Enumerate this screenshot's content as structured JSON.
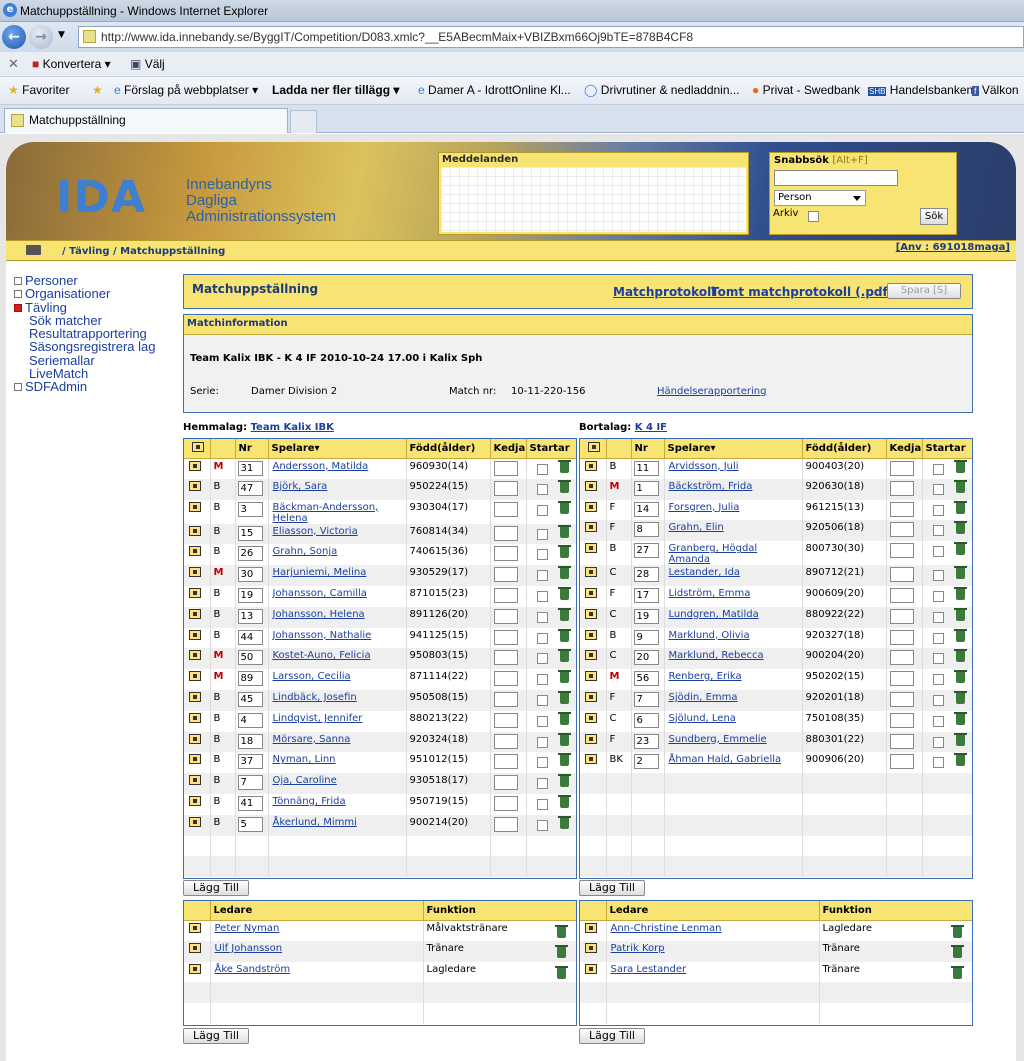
{
  "browser": {
    "title": "Matchuppställning - Windows Internet Explorer",
    "url": "http://www.ida.innebandy.se/ByggIT/Competition/D083.xmlc?__E5ABecmMaix+VBIZBxm66Oj9bTE=878B4CF8",
    "cmd": {
      "convert": "Konvertera",
      "select": "Välj"
    },
    "favorites": [
      "Favoriter",
      "Förslag på webbplatser",
      "Ladda ner fler tillägg",
      "Damer A - IdrottOnline Kl...",
      "Drivrutiner & nedladdnin...",
      "Privat - Swedbank",
      "Handelsbanken",
      "Välkon"
    ],
    "tab": "Matchuppställning"
  },
  "header": {
    "logo": "IDA",
    "logo_lines": [
      "Innebandyns",
      "Dagliga",
      "Administrationssystem"
    ],
    "messages_title": "Meddelanden",
    "quicksearch_title": "Snabbsök",
    "quicksearch_hint": "[Alt+F]",
    "search_type": "Person",
    "archive_label": "Arkiv",
    "search_button": "Sök",
    "breadcrumb": "/ Tävling / Matchuppställning",
    "user": "[Anv : 691018maga]"
  },
  "nav": {
    "personer": "Personer",
    "organisationer": "Organisationer",
    "tavling": "Tävling",
    "sok_matcher": "Sök matcher",
    "resultat": "Resultatrapportering",
    "sasong": "Säsongsregistrera lag",
    "seriemallar": "Seriemallar",
    "livematch": "LiveMatch",
    "sdfadmin": "SDFAdmin"
  },
  "main": {
    "title": "Matchuppställning",
    "protocol_link": "Matchprotokoll",
    "empty_protocol_link": "Tomt matchprotokoll (.pdf)",
    "save_button": "Spara [S]",
    "info_title": "Matchinformation",
    "match_title": "Team Kalix IBK - K 4 IF 2010-10-24 17.00  i Kalix Sph",
    "serie_label": "Serie:",
    "serie_value": "Damer Division 2",
    "match_nr_label": "Match nr:",
    "match_nr_value": "10-11-220-156",
    "events_link": "Händelserapportering"
  },
  "columns": {
    "nr": "Nr",
    "player": "Spelare",
    "born": "Född(ålder)",
    "line": "Kedja",
    "starter": "Startar",
    "leader": "Ledare",
    "function": "Funktion"
  },
  "add_button": "Lägg Till",
  "home": {
    "label": "Hemmalag:",
    "team": "Team Kalix IBK",
    "players": [
      {
        "pos": "M",
        "nr": "31",
        "name": "Andersson, Matilda",
        "born": "960930(14)"
      },
      {
        "pos": "B",
        "nr": "47",
        "name": "Björk, Sara",
        "born": "950224(15)"
      },
      {
        "pos": "B",
        "nr": "3",
        "name": "Bäckman-Andersson, Helena",
        "born": "930304(17)"
      },
      {
        "pos": "B",
        "nr": "15",
        "name": "Eliasson, Victoria",
        "born": "760814(34)"
      },
      {
        "pos": "B",
        "nr": "26",
        "name": "Grahn, Sonja",
        "born": "740615(36)"
      },
      {
        "pos": "M",
        "nr": "30",
        "name": "Harjuniemi, Melina",
        "born": "930529(17)"
      },
      {
        "pos": "B",
        "nr": "19",
        "name": "Johansson, Camilla",
        "born": "871015(23)"
      },
      {
        "pos": "B",
        "nr": "13",
        "name": "Johansson, Helena",
        "born": "891126(20)"
      },
      {
        "pos": "B",
        "nr": "44",
        "name": "Johansson, Nathalie",
        "born": "941125(15)"
      },
      {
        "pos": "M",
        "nr": "50",
        "name": "Kostet-Auno, Felicia",
        "born": "950803(15)"
      },
      {
        "pos": "M",
        "nr": "89",
        "name": "Larsson, Cecilia",
        "born": "871114(22)"
      },
      {
        "pos": "B",
        "nr": "45",
        "name": "Lindbäck, Josefin",
        "born": "950508(15)"
      },
      {
        "pos": "B",
        "nr": "4",
        "name": "Lindqvist, Jennifer",
        "born": "880213(22)"
      },
      {
        "pos": "B",
        "nr": "18",
        "name": "Mörsare, Sanna",
        "born": "920324(18)"
      },
      {
        "pos": "B",
        "nr": "37",
        "name": "Nyman, Linn",
        "born": "951012(15)"
      },
      {
        "pos": "B",
        "nr": "7",
        "name": "Oja, Caroline",
        "born": "930518(17)"
      },
      {
        "pos": "B",
        "nr": "41",
        "name": "Tönnäng, Frida",
        "born": "950719(15)"
      },
      {
        "pos": "B",
        "nr": "5",
        "name": "Åkerlund, Mimmi",
        "born": "900214(20)"
      }
    ],
    "leaders": [
      {
        "name": "Peter Nyman",
        "function": "Målvaktstränare"
      },
      {
        "name": "Ulf Johansson",
        "function": "Tränare"
      },
      {
        "name": "Åke Sandström",
        "function": "Lagledare"
      }
    ]
  },
  "away": {
    "label": "Bortalag:",
    "team": "K 4 IF",
    "players": [
      {
        "pos": "B",
        "nr": "11",
        "name": "Arvidsson, Juli",
        "born": "900403(20)"
      },
      {
        "pos": "M",
        "nr": "1",
        "name": "Bäckström, Frida",
        "born": "920630(18)"
      },
      {
        "pos": "F",
        "nr": "14",
        "name": "Forsgren, Julia",
        "born": "961215(13)"
      },
      {
        "pos": "F",
        "nr": "8",
        "name": "Grahn, Elin",
        "born": "920506(18)"
      },
      {
        "pos": "B",
        "nr": "27",
        "name": "Granberg, Högdal Amanda",
        "born": "800730(30)"
      },
      {
        "pos": "C",
        "nr": "28",
        "name": "Lestander, Ida",
        "born": "890712(21)"
      },
      {
        "pos": "F",
        "nr": "17",
        "name": "Lidström, Emma",
        "born": "900609(20)"
      },
      {
        "pos": "C",
        "nr": "19",
        "name": "Lundgren, Matilda",
        "born": "880922(22)"
      },
      {
        "pos": "B",
        "nr": "9",
        "name": "Marklund, Olivia",
        "born": "920327(18)"
      },
      {
        "pos": "C",
        "nr": "20",
        "name": "Marklund, Rebecca",
        "born": "900204(20)"
      },
      {
        "pos": "M",
        "nr": "56",
        "name": "Renberg, Erika",
        "born": "950202(15)"
      },
      {
        "pos": "F",
        "nr": "7",
        "name": "Sjödin, Emma",
        "born": "920201(18)"
      },
      {
        "pos": "C",
        "nr": "6",
        "name": "Sjölund, Lena",
        "born": "750108(35)"
      },
      {
        "pos": "F",
        "nr": "23",
        "name": "Sundberg, Emmelie",
        "born": "880301(22)"
      },
      {
        "pos": "BK",
        "nr": "2",
        "name": "Åhman Hald, Gabriella",
        "born": "900906(20)"
      }
    ],
    "leaders": [
      {
        "name": "Ann-Christine Lenman",
        "function": "Lagledare"
      },
      {
        "name": "Patrik Korp",
        "function": "Tränare"
      },
      {
        "name": "Sara Lestander",
        "function": "Tränare"
      }
    ]
  }
}
